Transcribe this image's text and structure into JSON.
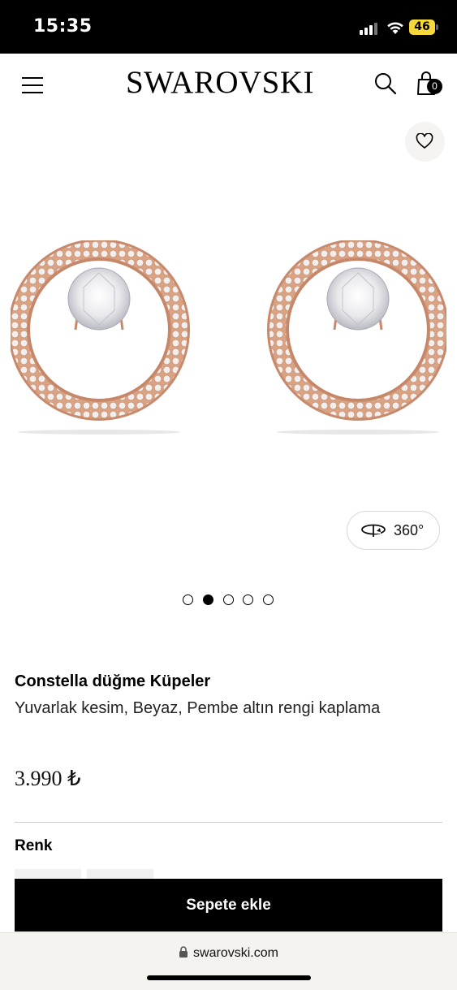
{
  "status_bar": {
    "time": "15:35",
    "battery": "46",
    "icons": [
      "signal-icon",
      "wifi-icon",
      "battery-icon"
    ]
  },
  "header": {
    "logo": "SWAROVSKI",
    "cart_count": "0",
    "icons": [
      "hamburger-menu-icon",
      "search-icon",
      "shopping-bag-icon"
    ]
  },
  "gallery": {
    "view_360_label": "360°",
    "wishlist_icon": "heart-icon",
    "slide_count": 5,
    "active_slide": 2
  },
  "product": {
    "name": "Constella düğme Küpeler",
    "description": "Yuvarlak kesim, Beyaz, Pembe altın rengi kaplama",
    "price": "3.990 ₺",
    "color_label": "Renk",
    "add_to_cart": "Sepete ekle"
  },
  "browser": {
    "url": "swarovski.com"
  },
  "colors": {
    "accent": "#000000",
    "rose_gold": "#d9a384",
    "battery": "#f7d83a",
    "url_bar": "#f4f3ef"
  }
}
